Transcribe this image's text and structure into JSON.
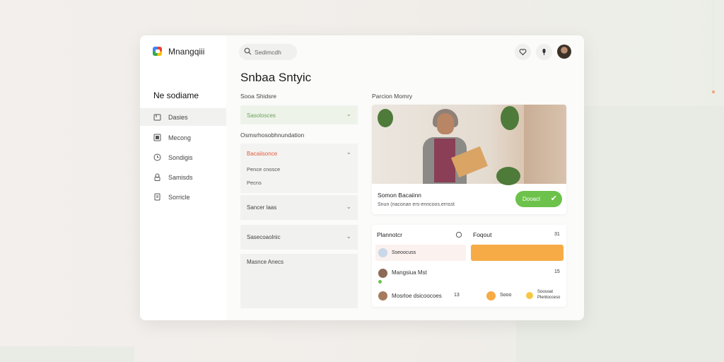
{
  "app": {
    "name": "Mnangqiii"
  },
  "sidebar": {
    "title": "Ne sodiame",
    "items": [
      {
        "label": "Dasies",
        "icon": "folder-icon",
        "active": true
      },
      {
        "label": "Mecong",
        "icon": "image-icon"
      },
      {
        "label": "Sondigis",
        "icon": "clock-icon"
      },
      {
        "label": "Samisds",
        "icon": "lock-icon"
      },
      {
        "label": "Sorricle",
        "icon": "document-icon"
      }
    ]
  },
  "header": {
    "search_placeholder": "Sedimcdh"
  },
  "main": {
    "title": "Snbaa Sntyic",
    "section1_label": "Sooa Shidsre",
    "field1_value": "Sasolosces",
    "section2_label": "Osmsrhosobhnundation",
    "field2_value": "Bacaiisonce",
    "field2_options": [
      "Pence cnosce",
      "Pecns"
    ],
    "field3_value": "Sancer laas",
    "field4_value": "Sasecoaolnic",
    "field5_value": "Masnce Anecs"
  },
  "profile_card": {
    "section_label": "Parcion Momry",
    "name": "Somon Bacaiinn",
    "subtitle": "Snun (naconan ers-enncoos.ernsst",
    "button_label": "Dooacl"
  },
  "list_card": {
    "header_left": "Plannotcr",
    "header_right": "Foqout",
    "header_count": "31",
    "row1_label": "Sseoocuss",
    "row2_name": "Mangsiua Mst",
    "row2_count": "15",
    "row3_name": "Mosrloe dsicoocoes",
    "row3_mid": "13",
    "row3_tag": "Sooo",
    "row3_right_top": "Soosoat",
    "row3_right_bottom": "Plenlocceso"
  },
  "colors": {
    "accent_green": "#6cc24a",
    "accent_orange": "#f6ab46"
  }
}
